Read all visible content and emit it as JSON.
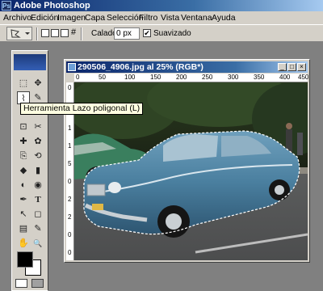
{
  "app": {
    "title": "Adobe Photoshop",
    "logo_text": "Ps"
  },
  "menubar": [
    "Archivo",
    "Edición",
    "Imagen",
    "Capa",
    "Selección",
    "Filtro",
    "Vista",
    "Ventana",
    "Ayuda"
  ],
  "options": {
    "feather_label": "Calado:",
    "feather_value": "0 px",
    "antialias_label": "Suavizado",
    "antialias_checked": true,
    "selection_mode_symbol": "#"
  },
  "document": {
    "title": "290506_4906.jpg al 25% (RGB*)",
    "ruler_h": [
      "0",
      "50",
      "100",
      "150",
      "200",
      "250",
      "300",
      "350",
      "400",
      "450"
    ],
    "ruler_v": [
      "0",
      "5",
      "1",
      "1",
      "5",
      "0",
      "2",
      "2",
      "0",
      "0"
    ]
  },
  "tooltip": "Herramienta Lazo poligonal (L)",
  "tools": {
    "labels": [
      "⬚",
      "✥",
      "⌇",
      "✎",
      "⊡",
      "✂",
      "✚",
      "✿",
      "⎘",
      "⟲",
      "◆",
      "▮",
      "◐",
      "◉",
      "✒",
      "T",
      "↖",
      "◻",
      "▤",
      "✎",
      "✋",
      "🔍"
    ]
  },
  "colors": {
    "foreground": "#000000",
    "background": "#ffffff",
    "accent": "#0a246a"
  }
}
